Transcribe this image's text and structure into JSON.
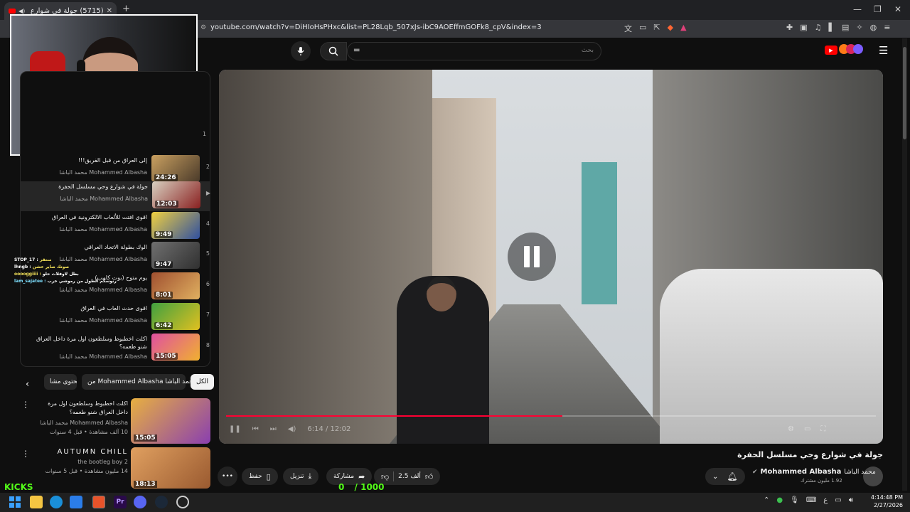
{
  "browser": {
    "tab_title": "(5715) جولة في شوارع وحي مـ...",
    "tab_close": "✕",
    "new_tab": "+",
    "url": "youtube.com/watch?v=DiHIoHsPHxc&list=PL28Lqb_507xJs-ibC9AOEffmGOFk8_cpV&index=3",
    "window_controls": [
      "—",
      "❐",
      "✕"
    ]
  },
  "youtube": {
    "search_placeholder": "بحث",
    "search_query": "▬",
    "video": {
      "time": "6:14 / 12:02",
      "progress": 0.518
    },
    "title": "جولة في شوارع وحي مسلسل الحفرة",
    "channel_name": "Mohammed Albasha",
    "channel_name_ar": "محمد الباشا",
    "subscribers": "1.92 مليون مشترك",
    "actions": {
      "like_count": "2.5 ألف",
      "share": "مشاركة",
      "download": "تنزيل",
      "save": "حفظ",
      "more": "•••"
    }
  },
  "playlist": [
    {
      "index": "1",
      "title": "",
      "channel": ""
    },
    {
      "index": "2",
      "title": "إلى العراق من قبل الفريق!!!",
      "channel": "Mohammed Albasha محمد الباشا",
      "duration": "24:26"
    },
    {
      "index": "▶",
      "title": "جولة في شوارع وحي مسلسل الحفرة",
      "channel": "Mohammed Albasha محمد الباشا",
      "duration": "12:03"
    },
    {
      "index": "4",
      "title": "اقوى افتت للألعاب الالكترونية في العراق",
      "channel": "Mohammed Albasha محمد الباشا",
      "duration": "9:49"
    },
    {
      "index": "5",
      "title": "الوك بطولة الاتحاد العراقي",
      "channel": "Mohammed Albasha محمد الباشا",
      "duration": "9:47"
    },
    {
      "index": "6",
      "title": "يوم متوح (بوت كامب)",
      "channel": "Mohammed Albasha محمد الباشا",
      "duration": "8:01"
    },
    {
      "index": "7",
      "title": "اقوى حدث العاب في العراق",
      "channel": "Mohammed Albasha محمد الباشا",
      "duration": "6:42"
    },
    {
      "index": "8",
      "title": "اكلت اخطبوط وسلطعون اول مرة داخل العراق شنو طعمه؟",
      "channel": "Mohammed Albasha محمد الباشا",
      "duration": "15:05"
    }
  ],
  "chips": [
    "الكل",
    "من Mohammed Albasha محمد الباشا",
    "محتوى مشا..."
  ],
  "recommended": [
    {
      "title": "اكلت اخطبوط وسلطعون اول مرة داخل العراق شنو طعمه؟",
      "channel": "Mohammed Albasha محمد الباشا",
      "meta": "10 آلف مشاهدة • قبل 4 سنوات",
      "duration": "15:05"
    },
    {
      "title": "AUTUMN CHILL",
      "channel": "the bootleg boy 2",
      "meta": "14 مليون مشاهدة • قبل 5 سنوات",
      "duration": "18:13"
    }
  ],
  "chat": [
    {
      "user": "STOP_17 :",
      "text": "منتقر"
    },
    {
      "user": "lhngb :",
      "text": "صوتك صاير خشن"
    },
    {
      "user": "ooooggiiii :",
      "text": "بطل لاوفلات حلو"
    },
    {
      "user": "lam_sajatee :",
      "text": "رنوسكم الطول من رموشي خرب"
    }
  ],
  "overlay": {
    "kicks_label": "KICKS",
    "kicks_count": "0",
    "kicks_goal": "/ 1000"
  },
  "taskbar": {
    "time": "4:14:48 PM",
    "date": "2/27/2026",
    "lang": "ع"
  }
}
